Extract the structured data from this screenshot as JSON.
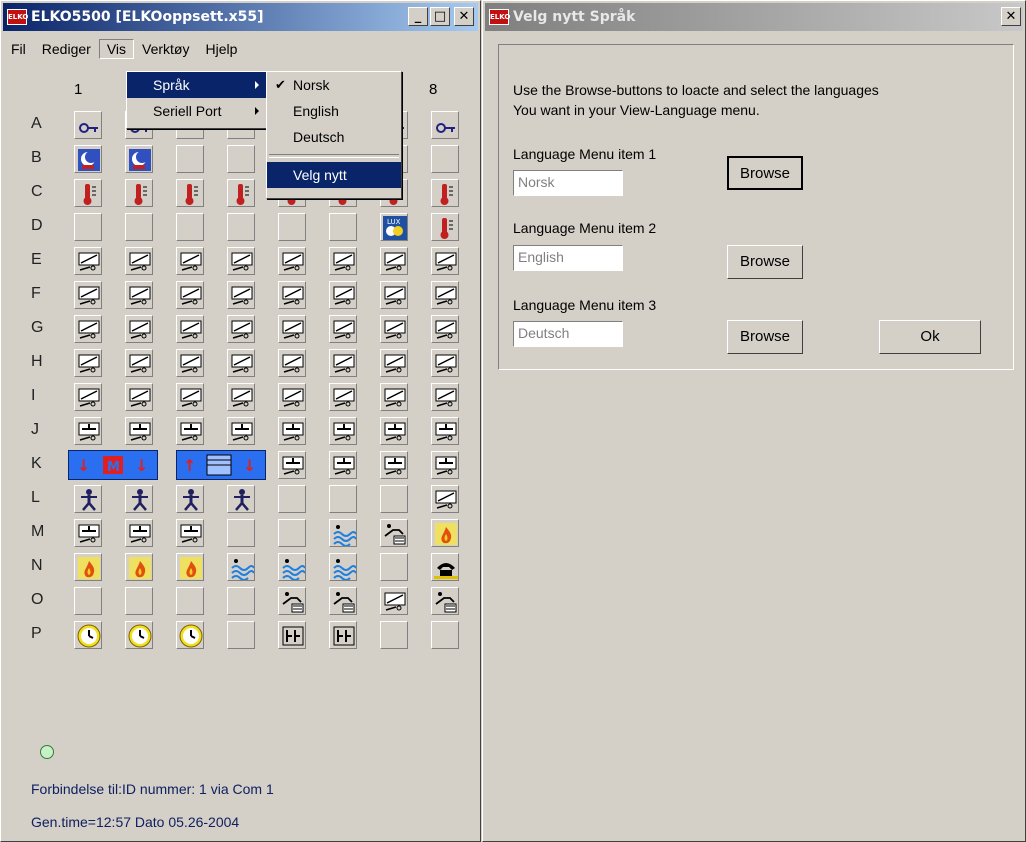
{
  "main_window": {
    "title": "ELKO5500 [ELKOoppsett.x55]",
    "logo_text": "ELKO",
    "controls": {
      "minimize": "_",
      "maximize": "□",
      "close": "✕"
    }
  },
  "menubar": {
    "items": [
      "Fil",
      "Rediger",
      "Vis",
      "Verktøy",
      "Hjelp"
    ]
  },
  "vis_menu": {
    "items": [
      "Språk",
      "Seriell Port"
    ]
  },
  "language_submenu": {
    "items": [
      "Norsk",
      "English",
      "Deutsch"
    ],
    "checked": "Norsk",
    "new_item": "Velg nytt"
  },
  "grid": {
    "columns": [
      "1",
      "8"
    ],
    "rows": [
      "A",
      "B",
      "C",
      "D",
      "E",
      "F",
      "G",
      "H",
      "I",
      "J",
      "K",
      "L",
      "M",
      "N",
      "O",
      "P"
    ],
    "cells": [
      "key,key,empty,empty,empty,empty,key,key",
      "moon,moon,empty,empty,empty,empty,empty,empty",
      "thermo,thermo,thermo,thermo,thermo,thermo,thermo,thermo",
      "empty,empty,empty,empty,empty,empty,lux,thermo",
      "switch,switch,switch,switch,switch,switch,switch,switch",
      "switch,switch,switch,switch,switch,switch,switch,switch",
      "switch,switch,switch,switch,switch,switch,switch,switch",
      "switch,switch,switch,switch,switch,switch,switch,switch",
      "switch,switch,switch,switch,switch,switch,switch,switch",
      "switch2,switch2,switch2,switch2,switch2,switch2,switch2,switch2",
      "none,none,none,none,switch2,switch2,switch2,switch2",
      "person,person,person,person,empty,empty,empty,switch",
      "switch2,switch2,switch2,empty,empty,wave,hand,fire",
      "fire,fire,fire,wave,wave,wave,empty,phone",
      "empty,empty,empty,empty,hand,hand,switch,hand",
      "clock,clock,clock,empty,relay,relay,empty,empty"
    ]
  },
  "status": {
    "connection": "Forbindelse til:ID nummer:  1  via Com  1",
    "gen_time": "Gen.time=12:57  Dato  05.26-2004"
  },
  "lang_dialog": {
    "title": "Velg nytt Språk",
    "close": "✕",
    "instruction_line1": "Use the Browse-buttons to loacte and select the languages",
    "instruction_line2": "You want in your View-Language menu.",
    "items": [
      {
        "label": "Language Menu item 1",
        "value": "Norsk",
        "browse": "Browse"
      },
      {
        "label": "Language Menu item 2",
        "value": "English",
        "browse": "Browse"
      },
      {
        "label": "Language Menu item 3",
        "value": "Deutsch",
        "browse": "Browse"
      }
    ],
    "ok": "Ok"
  },
  "colors": {
    "active_title": "#0a246a",
    "inactive_title": "#808080",
    "face": "#d4d0c8",
    "blind_blue": "#2a6ff0"
  }
}
